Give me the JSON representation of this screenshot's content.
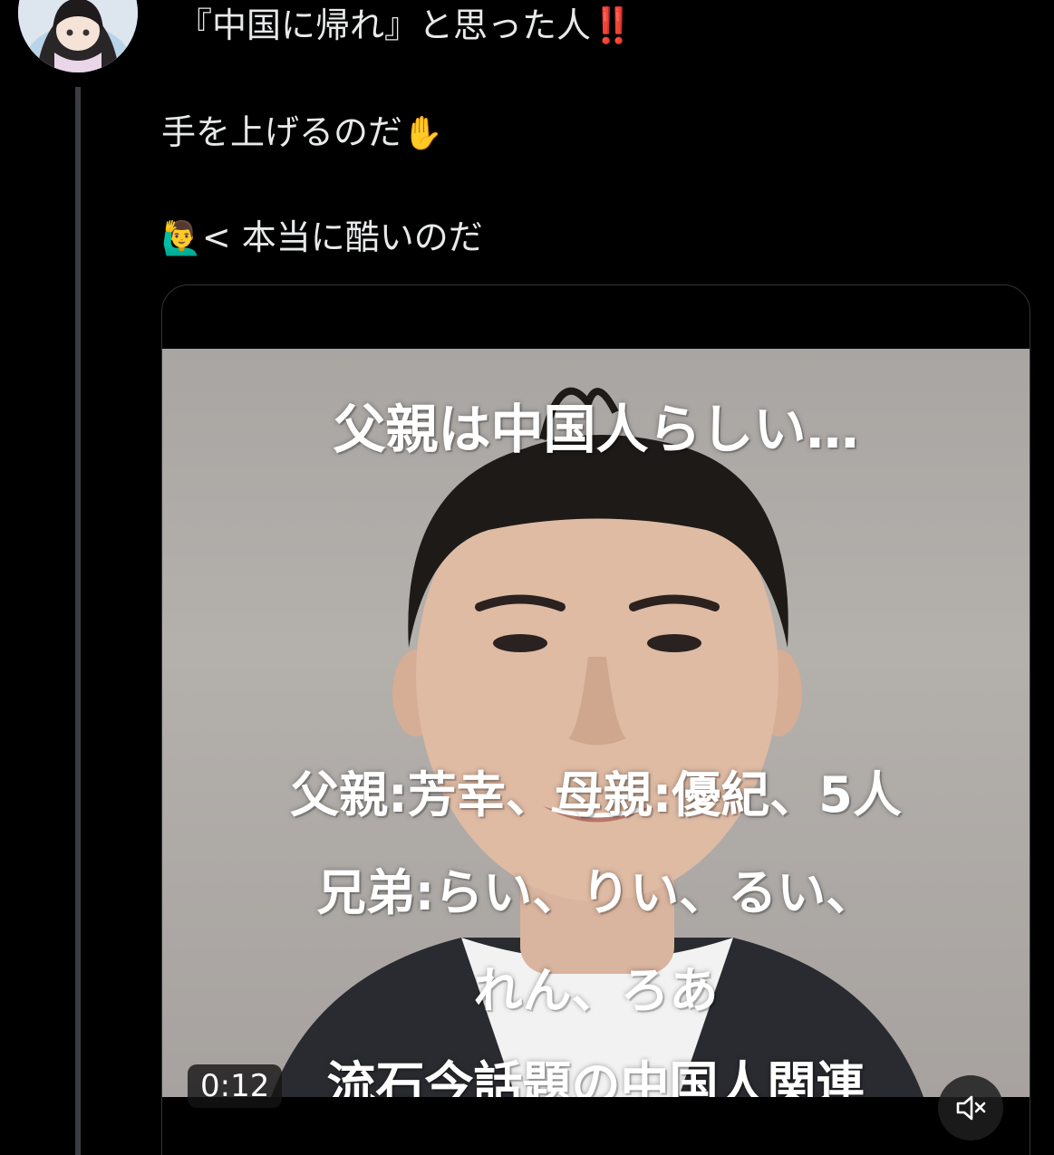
{
  "post": {
    "line1_text": "『中国に帰れ』と思った人",
    "line1_emoji": "‼️",
    "line2_text": "手を上げるのだ",
    "line2_emoji": "✋",
    "line3_emoji": "🙋‍♂️",
    "line3_text": "< 本当に酷いのだ"
  },
  "video": {
    "caption_title": "父親は中国人らしい…",
    "caption_line1": "父親:芳幸、母親:優紀、5人",
    "caption_line2": "兄弟:らい、りい、るい、",
    "caption_line3": "れん、ろあ",
    "caption_line4": "流石今話題の中国人関連",
    "elapsed_time": "0:12",
    "mute_icon": "speaker-muted-icon"
  },
  "colors": {
    "background": "#000000",
    "text": "#e7e9ea",
    "thread_line": "#3a3d41",
    "card_border": "#2f3336"
  }
}
